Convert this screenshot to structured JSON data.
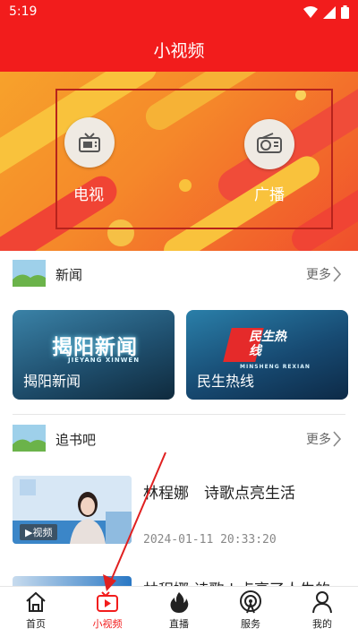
{
  "status_bar": {
    "time": "5:19"
  },
  "header": {
    "title": "小视频"
  },
  "banner": {
    "items": [
      {
        "label": "电视",
        "icon": "tv-icon"
      },
      {
        "label": "广播",
        "icon": "radio-icon"
      }
    ]
  },
  "sections": [
    {
      "title": "新闻",
      "more": "更多"
    },
    {
      "title": "追书吧",
      "more": "更多"
    }
  ],
  "news_cards": [
    {
      "caption": "揭阳新闻",
      "logo_text": "揭阳新闻",
      "logo_sub": "JIEYANG XINWEN"
    },
    {
      "caption": "民生热线",
      "logo_text": "民生热线",
      "logo_sub": "MINSHENG REXIAN"
    }
  ],
  "article": {
    "title": "林程娜　诗歌点亮生活",
    "timestamp": "2024-01-11 20:33:20",
    "badge": "▶视频",
    "next_title": "林程娜 诗歌 | 点亮了人生的"
  },
  "bottom_nav": [
    {
      "label": "首页",
      "icon": "home-icon",
      "active": false
    },
    {
      "label": "小视频",
      "icon": "video-icon",
      "active": true
    },
    {
      "label": "直播",
      "icon": "flame-icon",
      "active": false
    },
    {
      "label": "服务",
      "icon": "broadcast-icon",
      "active": false
    },
    {
      "label": "我的",
      "icon": "profile-icon",
      "active": false
    }
  ],
  "colors": {
    "brand": "#f21c1c",
    "annotation": "#b7231c"
  }
}
